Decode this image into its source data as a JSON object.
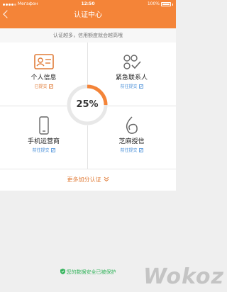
{
  "status_bar": {
    "carrier": "Мегафон",
    "time": "12:50",
    "battery": "100%"
  },
  "header": {
    "title": "认证中心"
  },
  "notice": "认证越多，信用额度就会越高哦",
  "progress": {
    "label": "25%",
    "value": 0.25
  },
  "items": [
    {
      "title": "个人信息",
      "status": "已提交"
    },
    {
      "title": "紧急联系人",
      "status": "前往提交"
    },
    {
      "title": "手机运营商",
      "status": "前往提交"
    },
    {
      "title": "芝麻授信",
      "status": "前往提交"
    }
  ],
  "more": {
    "label": "更多加分认证"
  },
  "footer": {
    "text": "您的数据安全已被保护"
  },
  "watermark": "Wokoz",
  "colors": {
    "accent": "#f48438",
    "link": "#4a90d9",
    "secure": "#34b45c"
  }
}
